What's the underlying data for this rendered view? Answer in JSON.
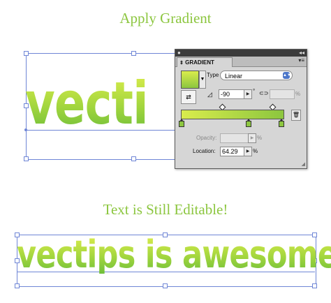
{
  "headings": {
    "top": "Apply Gradient",
    "bottom": "Text is Still Editable!"
  },
  "artwork": {
    "text_top": "vecti",
    "text_bottom": "vectips is awesome",
    "gradient_colors": [
      "#d9ec4c",
      "#8cc63f"
    ],
    "selection_color": "#6f86d6"
  },
  "panel": {
    "tab_label": "GRADIENT",
    "tab_icon": "diamond-arrow-icon",
    "titlebar_icon_left": "●",
    "titlebar_icon_right": "◂◂",
    "menu_icon": "▾≡",
    "type_label": "Type",
    "type_value": "Linear",
    "angle_value": "-90",
    "angle_unit": "°",
    "aspect_unit": "%",
    "opacity_label": "Opacity:",
    "opacity_unit": "%",
    "location_label": "Location:",
    "location_value": "64.29",
    "location_unit": "%"
  }
}
